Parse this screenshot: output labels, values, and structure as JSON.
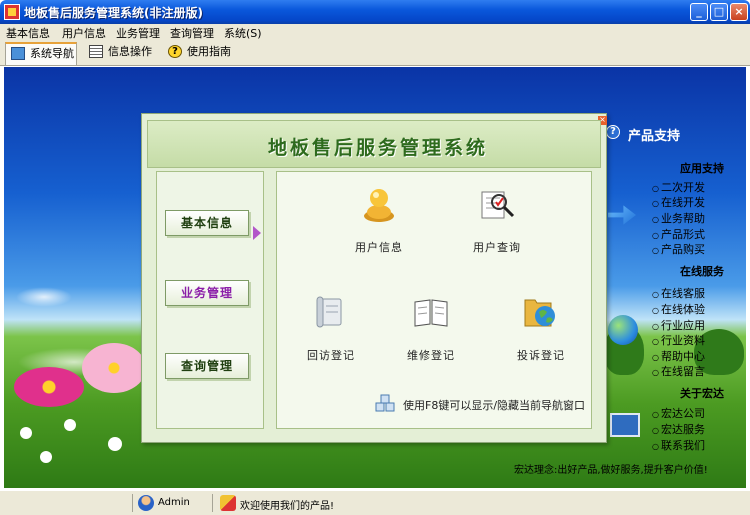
{
  "window": {
    "title": "地板售后服务管理系统(非注册版)",
    "controls": {
      "minimize": "_",
      "maximize": "□",
      "close": "×"
    }
  },
  "menu": [
    "基本信息",
    "用户信息",
    "业务管理",
    "查询管理",
    "系统(S)"
  ],
  "tabs": [
    {
      "label": "系统导航",
      "icon": "monitor-icon",
      "active": true
    },
    {
      "label": "信息操作",
      "icon": "grid-icon",
      "active": false
    },
    {
      "label": "使用指南",
      "icon": "help-icon",
      "active": false
    }
  ],
  "sidebar": {
    "title": "产品支持",
    "groups": [
      {
        "heading": "应用支持",
        "links": [
          "二次开发",
          "在线开发",
          "业务帮助",
          "产品形式",
          "产品购买"
        ]
      },
      {
        "heading": "在线服务",
        "links": [
          "在线客服",
          "在线体验",
          "行业应用",
          "行业资料",
          "帮助中心",
          "在线留言"
        ]
      },
      {
        "heading": "关于宏达",
        "links": [
          "宏达公司",
          "宏达服务",
          "联系我们"
        ]
      }
    ],
    "slogan": "宏达理念:出好产品,做好服务,提升客户价值!"
  },
  "nav_window": {
    "close": "×",
    "title": "地板售后服务管理系统",
    "left_buttons": [
      {
        "label": "基本信息",
        "active": false
      },
      {
        "label": "业务管理",
        "active": true
      },
      {
        "label": "查询管理",
        "active": false
      }
    ],
    "functions": [
      {
        "label": "用户信息",
        "icon": "user-icon"
      },
      {
        "label": "用户查询",
        "icon": "search-document-icon"
      },
      {
        "label": "回访登记",
        "icon": "scroll-icon"
      },
      {
        "label": "维修登记",
        "icon": "notebook-icon"
      },
      {
        "label": "投诉登记",
        "icon": "globe-folder-icon"
      }
    ],
    "hint": "使用F8键可以显示/隐藏当前导航窗口"
  },
  "status": {
    "user": "Admin",
    "message": "欢迎使用我们的产品!"
  },
  "colors": {
    "titlebar": "#0a58dc",
    "nav_title": "#2e6b1e",
    "active_nav": "#8b1ea8"
  }
}
